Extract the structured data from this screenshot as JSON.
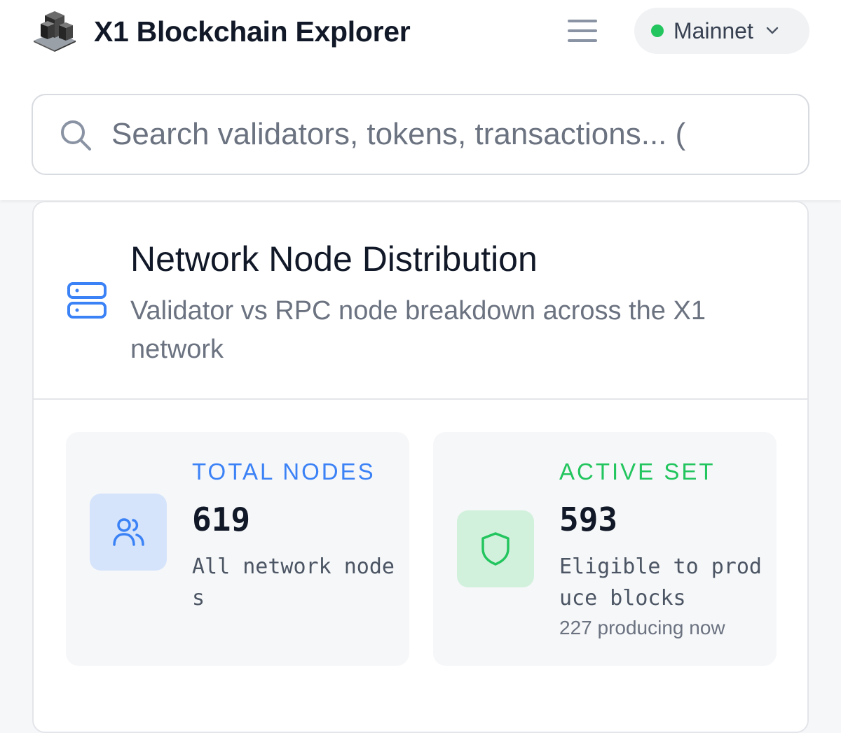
{
  "header": {
    "app_title": "X1 Blockchain Explorer",
    "logo_icon": "cube-stack-icon",
    "menu_icon": "hamburger-menu-icon",
    "network": {
      "label": "Mainnet",
      "status_color": "#22c55e",
      "icon": "chevron-down-icon"
    }
  },
  "search": {
    "placeholder": "Search validators, tokens, transactions... (",
    "icon": "search-icon"
  },
  "node_distribution": {
    "icon": "server-icon",
    "title": "Network Node Distribution",
    "subtitle": "Validator vs RPC node breakdown across the X1 network",
    "stats": [
      {
        "label": "TOTAL NODES",
        "value": "619",
        "description": "All network nodes",
        "icon": "users-icon",
        "accent": "#3b82f6"
      },
      {
        "label": "ACTIVE SET",
        "value": "593",
        "description": "Eligible to produce blocks",
        "note": "227 producing now",
        "icon": "shield-icon",
        "accent": "#22c55e"
      }
    ]
  }
}
